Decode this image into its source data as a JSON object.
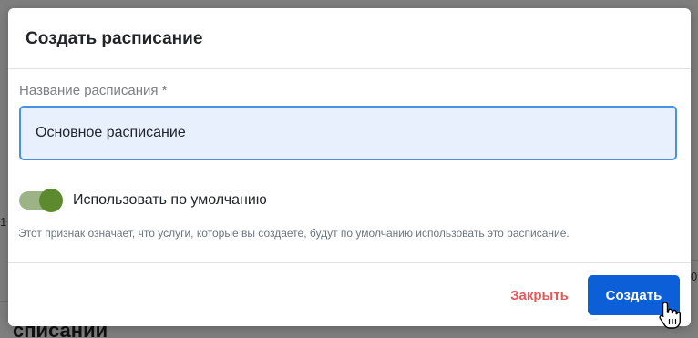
{
  "background": {
    "heading_fragment": "списании",
    "left_fragment": "1",
    "right_fragment": "0"
  },
  "modal": {
    "title": "Создать расписание",
    "name_field": {
      "label": "Название расписания *",
      "value": "Основное расписание"
    },
    "default_toggle": {
      "label": "Использовать по умолчанию",
      "checked": true,
      "help_text": "Этот признак означает, что услуги, которые вы создаете, будут по умолчанию использовать это расписание."
    },
    "footer": {
      "close_label": "Закрыть",
      "create_label": "Создать"
    }
  },
  "colors": {
    "accent": "#0d5fd8",
    "danger": "#e05a5a",
    "toggle_on": "#5e8a2f",
    "input_bg": "#e8f0fe",
    "input_border": "#4a90e2"
  },
  "icons": {
    "cursor": "hand-pointer-icon"
  }
}
